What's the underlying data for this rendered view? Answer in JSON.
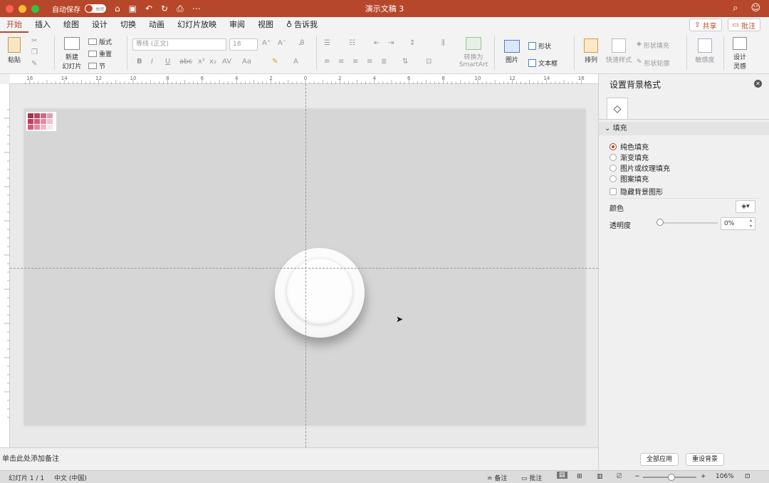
{
  "titlebar": {
    "autosave_label": "自动保存",
    "toggle_label": "关闭",
    "doc_title": "演示文稿 3"
  },
  "tabs": [
    "开始",
    "插入",
    "绘图",
    "设计",
    "切换",
    "动画",
    "幻灯片放映",
    "审阅",
    "视图"
  ],
  "tell_me": "告诉我",
  "share_label": "共享",
  "comments_label": "批注",
  "ribbon": {
    "paste": "粘贴",
    "new_slide_1": "新建",
    "new_slide_2": "幻灯片",
    "layout": "版式",
    "reset": "重置",
    "section": "节",
    "font_name": "等线 (正文)",
    "font_size": "18",
    "convert_1": "转换为",
    "convert_2": "SmartArt",
    "picture": "图片",
    "shape": "形状",
    "textbox": "文本框",
    "arrange": "排列",
    "quick_styles": "快速样式",
    "shape_fill": "形状填充",
    "shape_outline": "形状轮廓",
    "sensitivity": "敏感度",
    "designer_1": "设计",
    "designer_2": "灵感"
  },
  "ruler_labels": [
    "16",
    "14",
    "12",
    "10",
    "8",
    "6",
    "4",
    "2",
    "0",
    "2",
    "4",
    "6",
    "8",
    "10",
    "12",
    "14",
    "16"
  ],
  "swatch_colors": [
    "#a3364f",
    "#b84863",
    "#cc6a82",
    "#e0a0b1",
    "#c23d5c",
    "#d45f7b",
    "#e38aa0",
    "#f0c0cc",
    "#d9577a",
    "#e688a2",
    "#f1b6c6",
    "#fbe3ea"
  ],
  "notes_placeholder": "单击此处添加备注",
  "status": {
    "slide_info": "幻灯片 1 / 1",
    "language": "中文 (中国)",
    "notes": "备注",
    "comments": "批注",
    "zoom_minus": "−",
    "zoom_plus": "+",
    "zoom": "106%"
  },
  "pane": {
    "title": "设置背景格式",
    "section": "填充",
    "options": [
      "纯色填充",
      "渐变填充",
      "图片或纹理填充",
      "图案填充"
    ],
    "hide_bg": "隐藏背景图形",
    "color_label": "颜色",
    "transparency_label": "透明度",
    "transparency_value": "0%",
    "apply_all": "全部应用",
    "reset_bg": "重设背景"
  },
  "colors": {
    "accent": "#b7472a",
    "slide_bg": "#d6d6d6"
  }
}
